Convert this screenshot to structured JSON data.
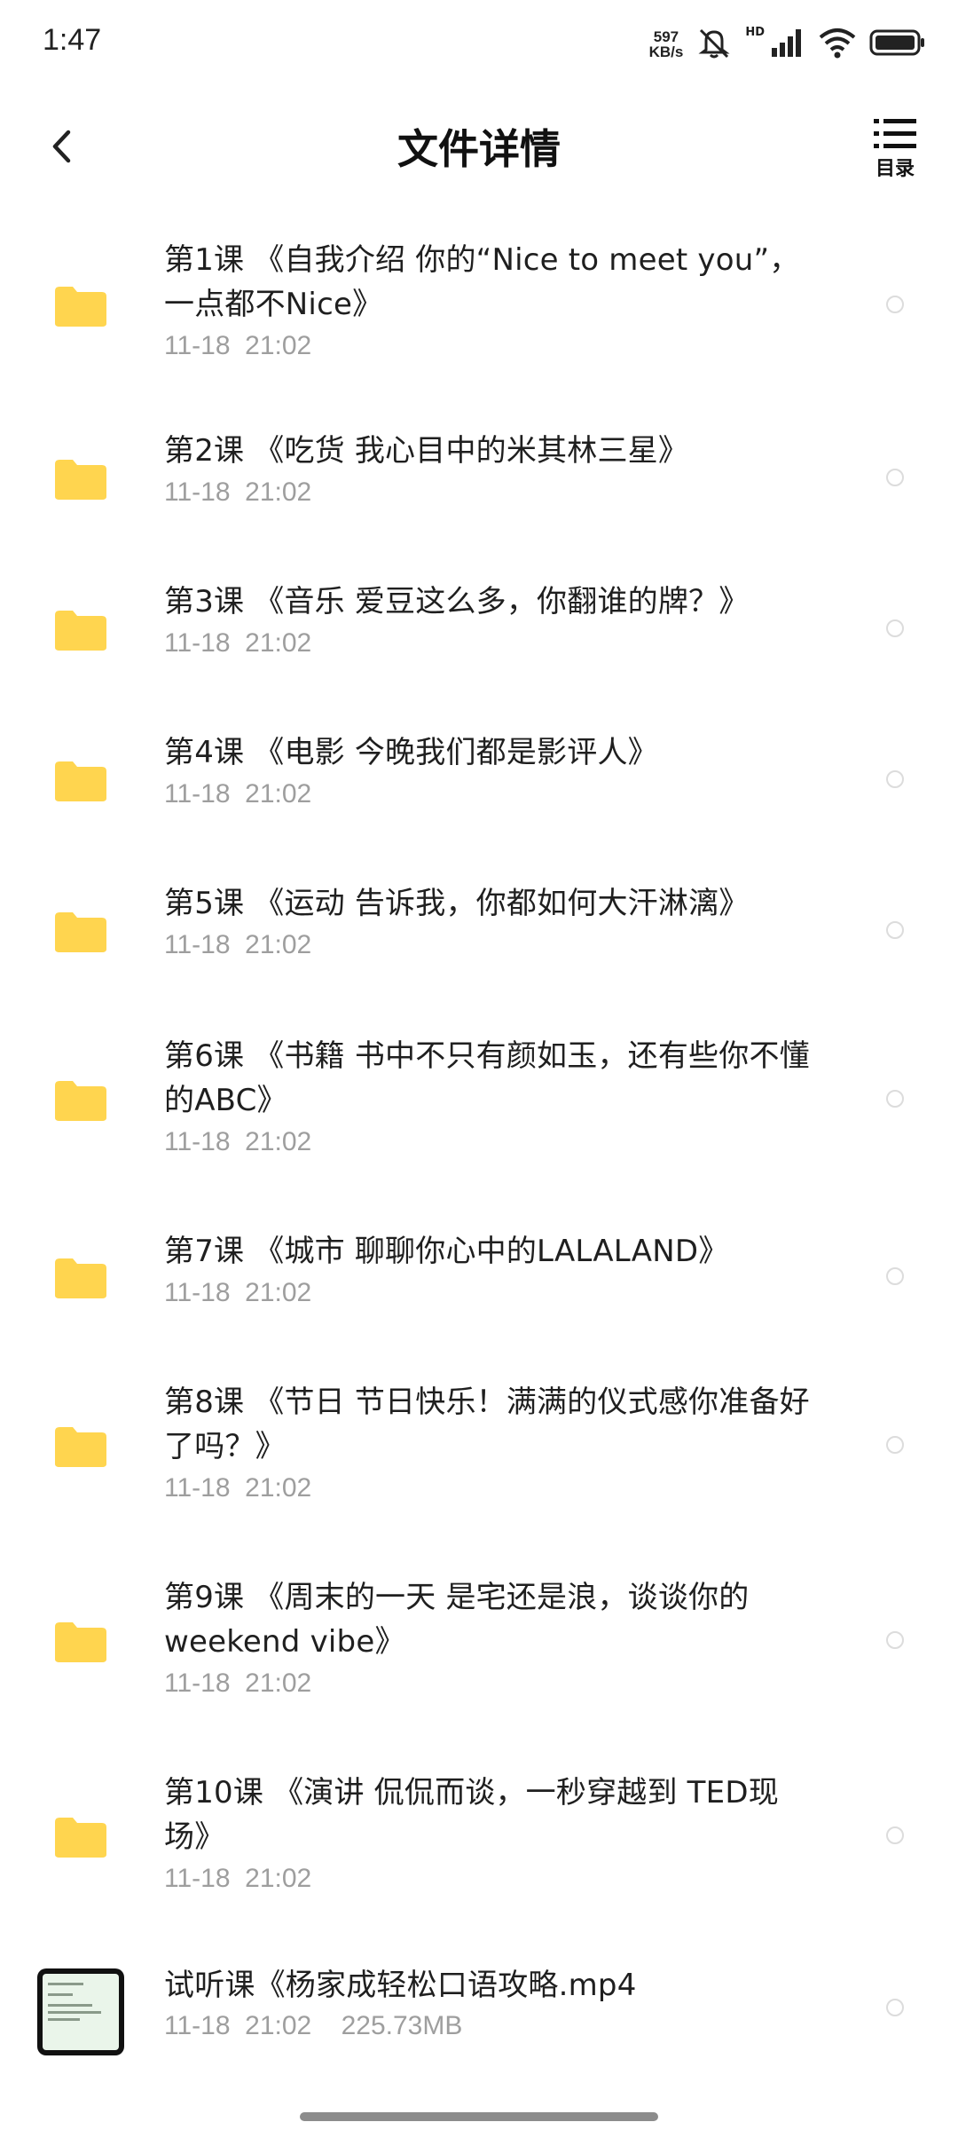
{
  "status_bar": {
    "time": "1:47",
    "net_speed_value": "597",
    "net_speed_unit": "KB/s",
    "hd_label": "HD",
    "icons": [
      "mute-icon",
      "signal-icon",
      "wifi-icon",
      "battery-icon"
    ]
  },
  "header": {
    "title": "文件详情",
    "toc_label": "目录"
  },
  "colors": {
    "folder": "#FFD54F",
    "meta_text": "#9E9E9E"
  },
  "files": [
    {
      "icon": "folder-icon",
      "title": "第1课 《自我介绍  你的“Nice to meet you”，一点都不Nice》",
      "date": "11-18  21:02"
    },
    {
      "icon": "folder-icon",
      "title": "第2课 《吃货  我心目中的米其林三星》",
      "date": "11-18  21:02"
    },
    {
      "icon": "folder-icon",
      "title": "第3课 《音乐  爱豆这么多，你翻谁的牌？》",
      "date": "11-18  21:02"
    },
    {
      "icon": "folder-icon",
      "title": "第4课 《电影  今晚我们都是影评人》",
      "date": "11-18  21:02"
    },
    {
      "icon": "folder-icon",
      "title": "第5课 《运动  告诉我，你都如何大汗淋漓》",
      "date": "11-18  21:02"
    },
    {
      "icon": "folder-icon",
      "title": "第6课 《书籍  书中不只有颜如玉，还有些你不懂的ABC》",
      "date": "11-18  21:02"
    },
    {
      "icon": "folder-icon",
      "title": "第7课 《城市  聊聊你心中的LALALAND》",
      "date": "11-18  21:02"
    },
    {
      "icon": "folder-icon",
      "title": "第8课 《节日  节日快乐！满满的仪式感你准备好了吗？》",
      "date": "11-18  21:02"
    },
    {
      "icon": "folder-icon",
      "title": "第9课 《周末的一天  是宅还是浪，谈谈你的weekend vibe》",
      "date": "11-18  21:02"
    },
    {
      "icon": "folder-icon",
      "title": "第10课 《演讲  侃侃而谈，一秒穿越到 TED现场》",
      "date": "11-18  21:02"
    },
    {
      "icon": "video-thumbnail-icon",
      "title": "试听课《杨家成轻松口语攻略.mp4",
      "date": "11-18  21:02    225.73MB"
    }
  ]
}
